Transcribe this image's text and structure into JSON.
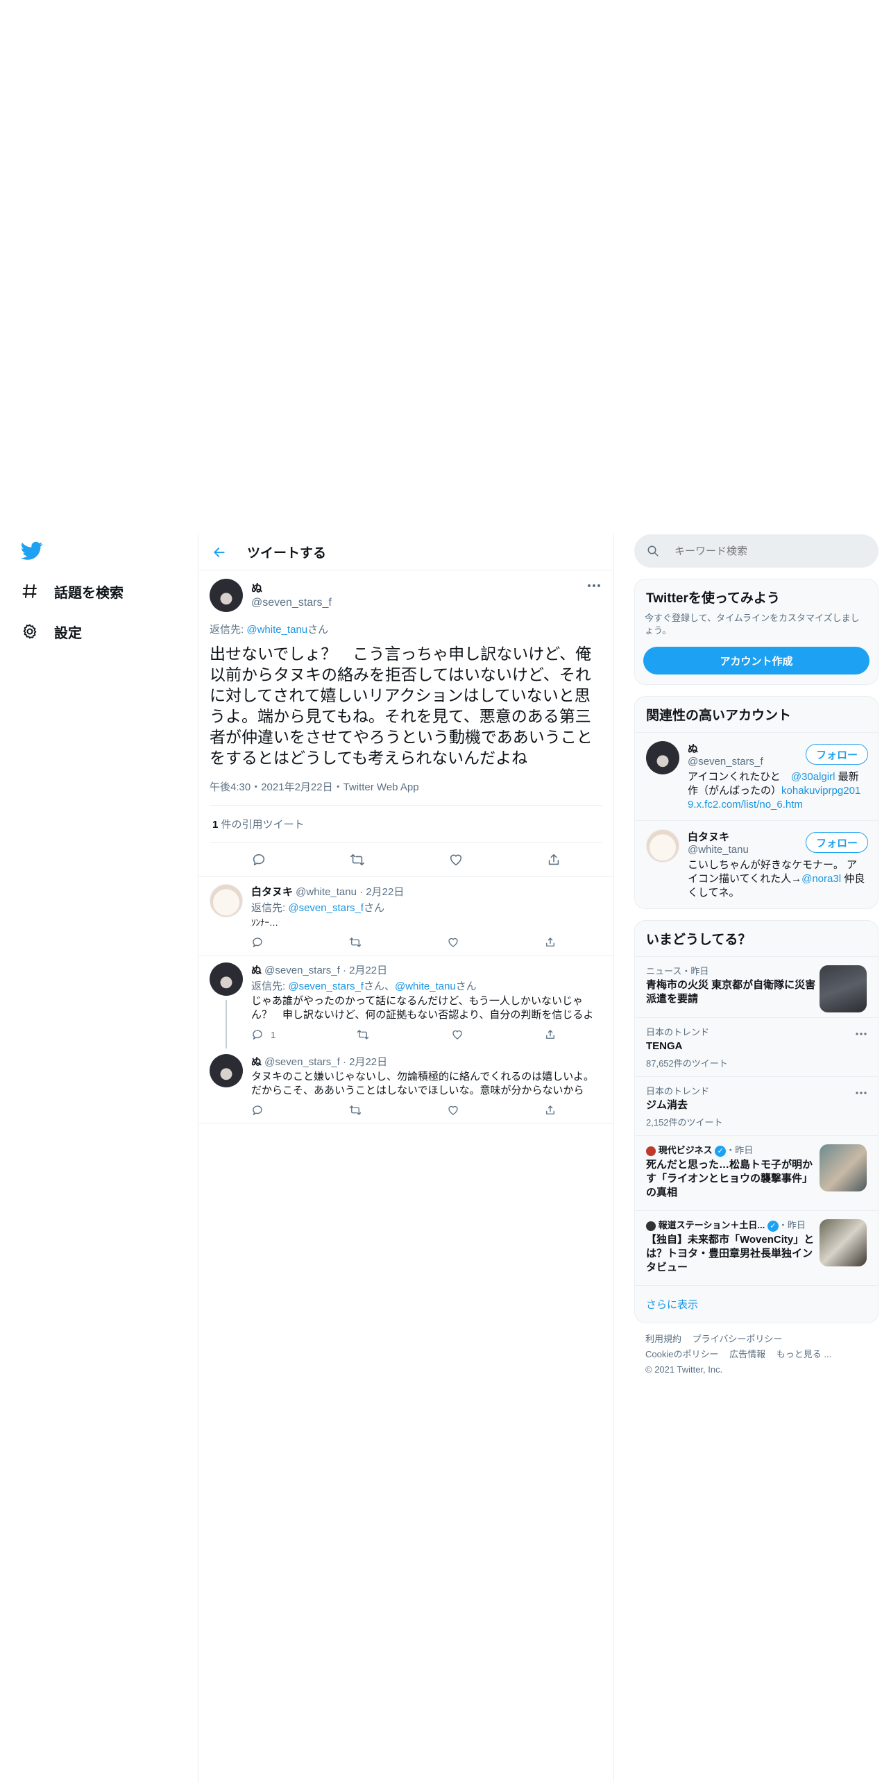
{
  "nav": {
    "explore_label": "話題を検索",
    "settings_label": "設定"
  },
  "header": {
    "title": "ツイートする"
  },
  "main_tweet": {
    "name": "ぬ",
    "handle": "@seven_stars_f",
    "reply_prefix": "返信先: ",
    "reply_to": "@white_tanu",
    "reply_suffix": "さん",
    "text": "出せないでしょ？　こう言っちゃ申し訳ないけど、俺以前からタヌキの絡みを拒否してはいないけど、それに対してされて嬉しいリアクションはしていないと思うよ。端から見てもね。それを見て、悪意のある第三者が仲違いをさせてやろうという動機であ​あいうことをするとはどうしても考えられないんだよね",
    "meta": "午後4:30・2021年2月22日・Twitter Web App",
    "quote_count": "1",
    "quote_label": " 件の引用ツイート"
  },
  "replies": [
    {
      "name": "白タヌキ",
      "handle_date": " @white_tanu · 2月22日",
      "reply_prefix": "返信先: ",
      "reply_to": "@seven_stars_f",
      "reply_to_2": "",
      "reply_suffix": "さん",
      "text": "ｿﾝﾅｰ…",
      "reply_count": ""
    },
    {
      "name": "ぬ",
      "handle_date": " @seven_stars_f · 2月22日",
      "reply_prefix": "返信先: ",
      "reply_to": "@seven_stars_f",
      "reply_to_2": "@white_tanu",
      "reply_mid": "さん、",
      "reply_suffix": "さん",
      "text": "じゃあ誰がやったのかって話になるんだけど、もう一人しかいないじゃん？　申し訳ないけど、何の証拠もない否認より、自分の判断を信じるよ",
      "reply_count": "1"
    },
    {
      "name": "ぬ",
      "handle_date": " @seven_stars_f · 2月22日",
      "text": "タヌキのこと嫌いじゃないし、勿論積極的に絡んでくれるのは嬉しいよ。だからこそ、ああいうことはしないでほしいな。意味が分からないから"
    }
  ],
  "right": {
    "search_placeholder": "キーワード検索",
    "signup": {
      "title": "Twitterを使ってみよう",
      "desc": "今すぐ登録して、タイムラインをカスタマイズしましょう。",
      "button": "アカウント作成"
    },
    "relevant": {
      "title": "関連性の高いアカウント",
      "accounts": [
        {
          "name": "ぬ",
          "handle": "@seven_stars_f",
          "follow": "フォロー",
          "bio_1": "アイコンくれたひと　",
          "bio_link_1": "@30algirl",
          "bio_2": " 最新作（がんばったの）",
          "bio_link_2": "kohakuviprpg2019.x.fc2.com/list/no_6.htm"
        },
        {
          "name": "白タヌキ",
          "handle": "@white_tanu",
          "follow": "フォロー",
          "bio_1": "こいしちゃんが好きなケモナー。 アイコン描いてくれた人→",
          "bio_link_1": "@nora3l",
          "bio_2": " 仲良くしてネ。"
        }
      ]
    },
    "trends": {
      "title": "いまどうしてる？",
      "items": [
        {
          "meta": "ニュース・昨日",
          "title": "青梅市の火災 東京都が自衛隊に災害派遣を要請",
          "count": ""
        },
        {
          "meta": "日本のトレンド",
          "title": "TENGA",
          "count": "87,652件のツイート"
        },
        {
          "meta": "日本のトレンド",
          "title": "ジム消去",
          "count": "2,152件のツイート"
        },
        {
          "source": "現代ビジネス",
          "meta": "・昨日",
          "title": "死んだと思った…松島トモ子が明かす「ライオンとヒョウの襲撃事件」の真相",
          "count": ""
        },
        {
          "source": "報道ステーション＋土日...",
          "meta": "・昨日",
          "title": "【独自】未来都市「WovenCity」とは？トヨタ・豊田章男社長単独インタビュー",
          "count": ""
        }
      ],
      "show_more": "さらに表示"
    },
    "footer": {
      "links_1": [
        "利用規約",
        "プライバシーポリシー"
      ],
      "links_2": [
        "Cookieのポリシー",
        "広告情報",
        "もっと見る ..."
      ],
      "copyright": "© 2021 Twitter, Inc."
    }
  },
  "colors": {
    "accent": "#1da1f2",
    "link": "#1b95e0",
    "muted": "#5b7083",
    "border": "#ebeef0"
  }
}
